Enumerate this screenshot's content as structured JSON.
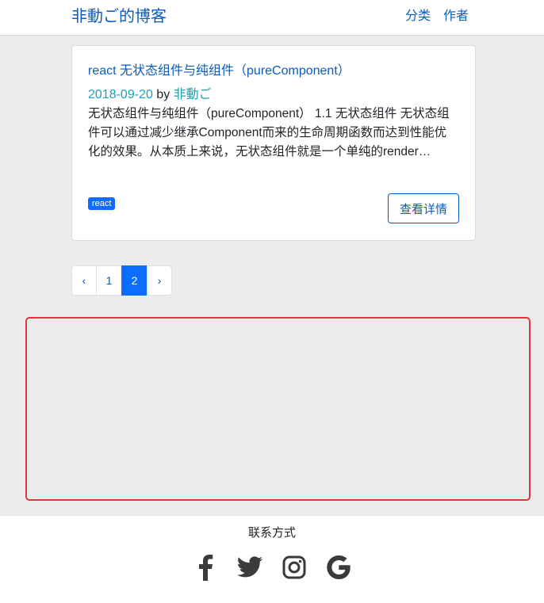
{
  "header": {
    "brand": "非動ご的博客",
    "nav": [
      {
        "label": "分类"
      },
      {
        "label": "作者"
      }
    ]
  },
  "post": {
    "title": "react 无状态组件与纯组件（pureComponent）",
    "date": "2018-09-20",
    "by": "by",
    "author": "非動ご",
    "excerpt": "无状态组件与纯组件（pureComponent） 1.1 无状态组件 无状态组件可以通过减少继承Component而来的生命周期函数而达到性能优化的效果。从本质上来说，无状态组件就是一个单纯的render…",
    "tag": "react",
    "details_label": "查看详情"
  },
  "pagination": {
    "prev": "‹",
    "pages": [
      "1",
      "2"
    ],
    "active_page": "2",
    "next": "›"
  },
  "footer": {
    "title": "联系方式",
    "icons": [
      "facebook-icon",
      "twitter-icon",
      "instagram-icon",
      "google-icon"
    ]
  },
  "colors": {
    "link": "#0a5cc0",
    "accent": "#0d6efd",
    "meta": "#17a2b8",
    "highlight_border": "#e3343f"
  }
}
